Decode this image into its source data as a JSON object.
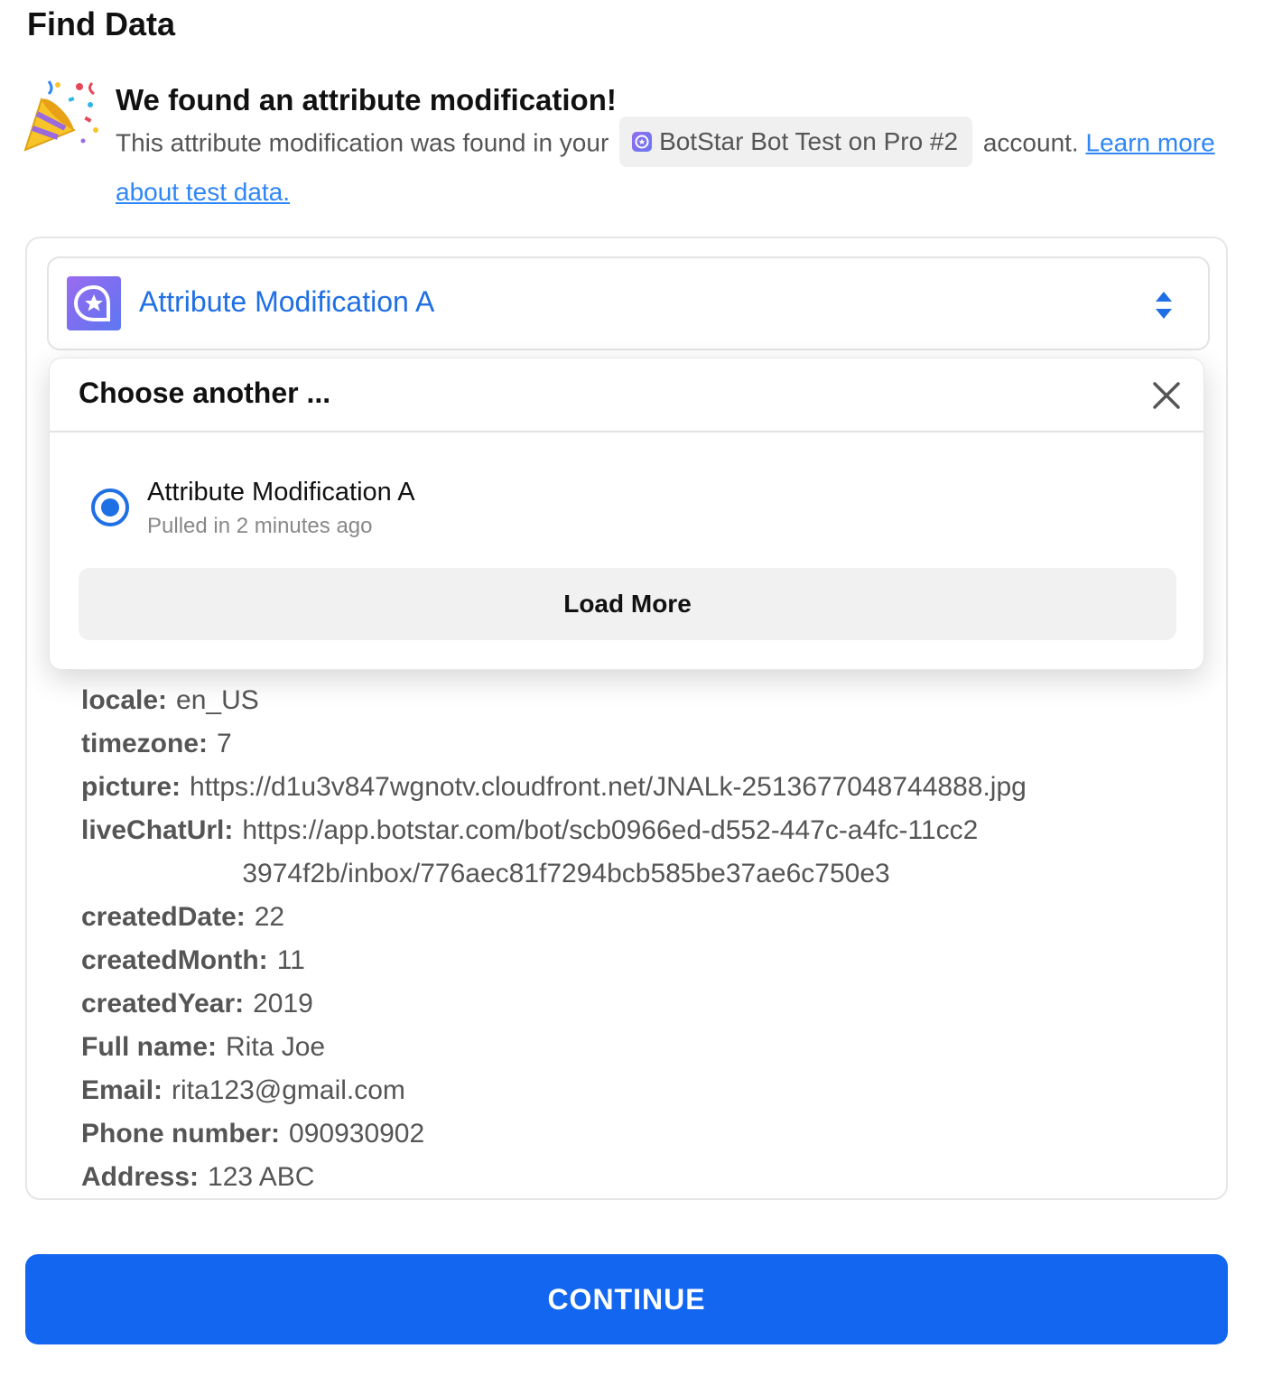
{
  "page": {
    "title": "Find Data"
  },
  "found": {
    "heading": "We found an attribute modification!",
    "text_before": "This attribute modification was found in your",
    "account_name": "BotStar Bot Test on Pro #2",
    "text_after": "account.",
    "learn_link": "Learn more about test data."
  },
  "selector": {
    "label": "Attribute Modification A",
    "icon": "botstar-logo"
  },
  "dropdown": {
    "title": "Choose another ...",
    "options": [
      {
        "title": "Attribute Modification A",
        "subtitle": "Pulled in 2 minutes ago",
        "selected": true
      }
    ],
    "load_more_label": "Load More"
  },
  "record": [
    {
      "key": "locale:",
      "value": "en_US"
    },
    {
      "key": "timezone:",
      "value": "7"
    },
    {
      "key": "picture:",
      "value": "https://d1u3v847wgnotv.cloudfront.net/JNALk-2513677048744888.jpg"
    },
    {
      "key": "liveChatUrl:",
      "value": "https://app.botstar.com/bot/scb0966ed-d552-447c-a4fc-11cc23974f2b/inbox/776aec81f7294bcb585be37ae6c750e3"
    },
    {
      "key": "createdDate:",
      "value": "22"
    },
    {
      "key": "createdMonth:",
      "value": "11"
    },
    {
      "key": "createdYear:",
      "value": "2019"
    },
    {
      "key": "Full name:",
      "value": "Rita Joe"
    },
    {
      "key": "Email:",
      "value": "rita123@gmail.com"
    },
    {
      "key": "Phone number:",
      "value": "090930902"
    },
    {
      "key": "Address:",
      "value": "123 ABC"
    }
  ],
  "continue_label": "CONTINUE",
  "colors": {
    "accent": "#1366f0",
    "link": "#2f86f5",
    "selector_text": "#1f6fe5"
  }
}
